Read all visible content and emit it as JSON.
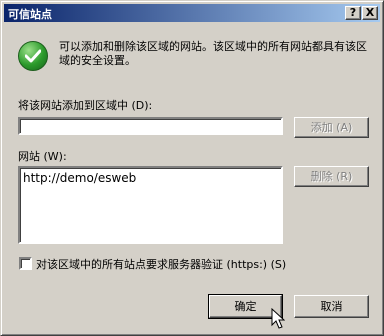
{
  "window": {
    "title": "可信站点",
    "help_label": "?",
    "close_label": "X"
  },
  "info": {
    "text": "可以添加和删除该区域的网站。该区域中的所有网站都具有该区域的安全设置。",
    "icon": "check-shield-icon",
    "icon_color": "#2b9a2b"
  },
  "add_section": {
    "label": "将该网站添加到区域中 (D):",
    "input_value": "",
    "add_button": "添加 (A)"
  },
  "sites_section": {
    "label": "网站 (W):",
    "items": [
      "http://demo/esweb"
    ],
    "remove_button": "删除 (R)"
  },
  "https_option": {
    "label": "对该区域中的所有站点要求服务器验证 (https:) (S)",
    "checked": false
  },
  "footer": {
    "ok": "确定",
    "cancel": "取消"
  }
}
